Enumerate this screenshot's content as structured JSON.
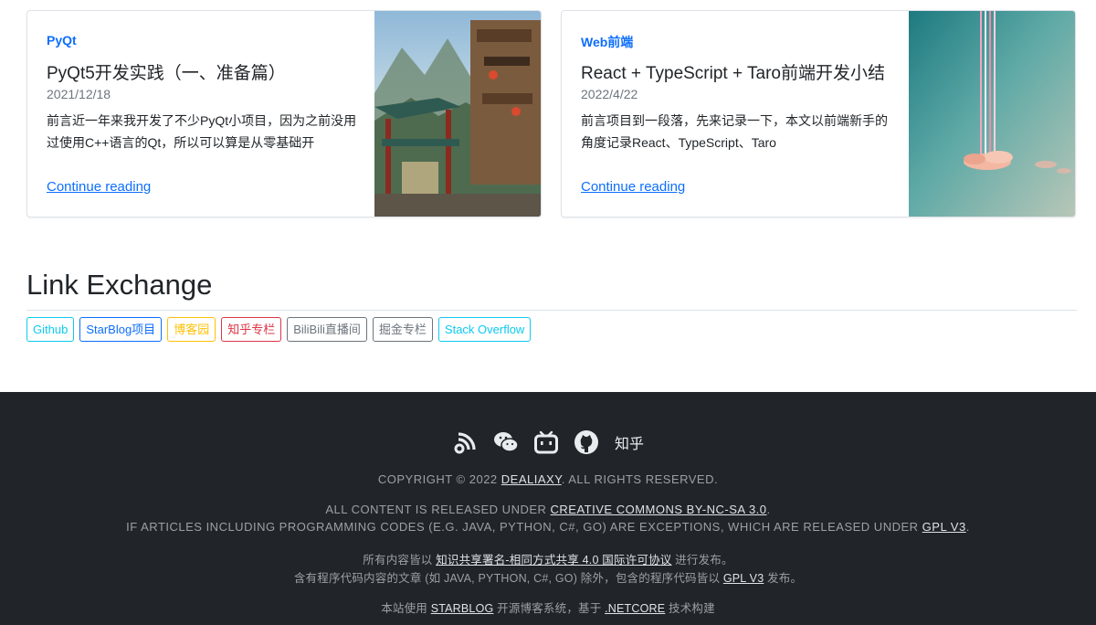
{
  "posts": [
    {
      "category": "PyQt",
      "title": "PyQt5开发实践（一、准备篇）",
      "date": "2021/12/18",
      "excerpt": "前言近一年来我开发了不少PyQt小项目，因为之前没用过使用C++语言的Qt，所以可以算是从零基础开",
      "read_more": "Continue reading"
    },
    {
      "category": "Web前端",
      "title": "React + TypeScript + Taro前端开发小结",
      "date": "2022/4/22",
      "excerpt": "前言项目到一段落，先来记录一下，本文以前端新手的角度记录React、TypeScript、Taro",
      "read_more": "Continue reading"
    }
  ],
  "links": {
    "heading": "Link Exchange",
    "items": [
      {
        "label": "Github",
        "color": "#0dcaf0"
      },
      {
        "label": "StarBlog项目",
        "color": "#0d6efd"
      },
      {
        "label": "博客园",
        "color": "#ffc107"
      },
      {
        "label": "知乎专栏",
        "color": "#dc3545"
      },
      {
        "label": "BiliBili直播间",
        "color": "#6c757d"
      },
      {
        "label": "掘金专栏",
        "color": "#6c757d"
      },
      {
        "label": "Stack Overflow",
        "color": "#0dcaf0"
      }
    ]
  },
  "footer": {
    "icons": [
      "rss-icon",
      "wechat-icon",
      "bilibili-icon",
      "github-icon"
    ],
    "zhihu_label": "知乎",
    "copyright_prefix": "COPYRIGHT © 2022",
    "copyright_author": "DEALIAXY",
    "copyright_suffix": ". ALL RIGHTS RESERVED.",
    "license_prefix": "ALL CONTENT IS RELEASED UNDER",
    "license_link": "CREATIVE COMMONS BY-NC-SA 3.0",
    "license_suffix": ".",
    "code_prefix": "IF ARTICLES INCLUDING PROGRAMMING CODES (E.G. JAVA, PYTHON, C#, GO) ARE EXCEPTIONS, WHICH ARE RELEASED UNDER",
    "code_link": "GPL V3",
    "code_suffix": ".",
    "cn_license_prefix": "所有内容皆以",
    "cn_license_link": "知识共享署名-相同方式共享 4.0 国际许可协议",
    "cn_license_suffix": "进行发布。",
    "cn_code_prefix": "含有程序代码内容的文章 (如 JAVA, PYTHON, C#, GO) 除外，包含的程序代码皆以",
    "cn_code_link": "GPL V3",
    "cn_code_suffix": "发布。",
    "built_prefix": "本站使用",
    "built_link1": "STARBLOG",
    "built_mid": "开源博客系统，基于",
    "built_link2": ".NETCORE",
    "built_suffix": "技术构建"
  }
}
